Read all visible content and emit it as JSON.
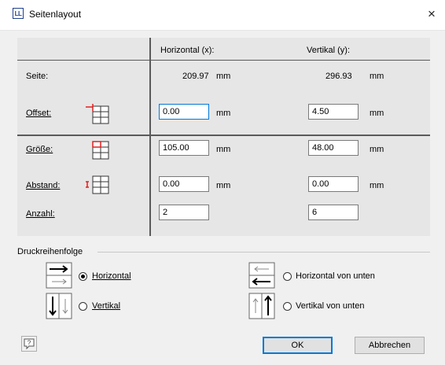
{
  "window": {
    "title": "Seitenlayout",
    "app_icon": "LL",
    "close": "×"
  },
  "grid": {
    "col_horizontal": "Horizontal (x):",
    "col_vertical": "Vertikal (y):",
    "rows": {
      "seite": {
        "label": "Seite:",
        "x": "209.97",
        "y": "296.93",
        "unit": "mm"
      },
      "offset": {
        "label": "Offset:",
        "x": "0.00",
        "y": "4.50",
        "unit": "mm"
      },
      "groesse": {
        "label": "Größe:",
        "x": "105.00",
        "y": "48.00",
        "unit": "mm"
      },
      "abstand": {
        "label": "Abstand:",
        "x": "0.00",
        "y": "0.00",
        "unit": "mm"
      },
      "anzahl": {
        "label": "Anzahl:",
        "x": "2",
        "y": "6"
      }
    }
  },
  "order": {
    "label": "Druckreihenfolge",
    "options": [
      {
        "label": "Horizontal",
        "checked": true
      },
      {
        "label": "Vertikal",
        "checked": false
      },
      {
        "label": "Horizontal von unten",
        "checked": false
      },
      {
        "label": "Vertikal von unten",
        "checked": false
      }
    ]
  },
  "buttons": {
    "ok": "OK",
    "cancel": "Abbrechen",
    "help": "?"
  },
  "colors": {
    "accent": "#0078d7",
    "marker": "#e02020"
  }
}
